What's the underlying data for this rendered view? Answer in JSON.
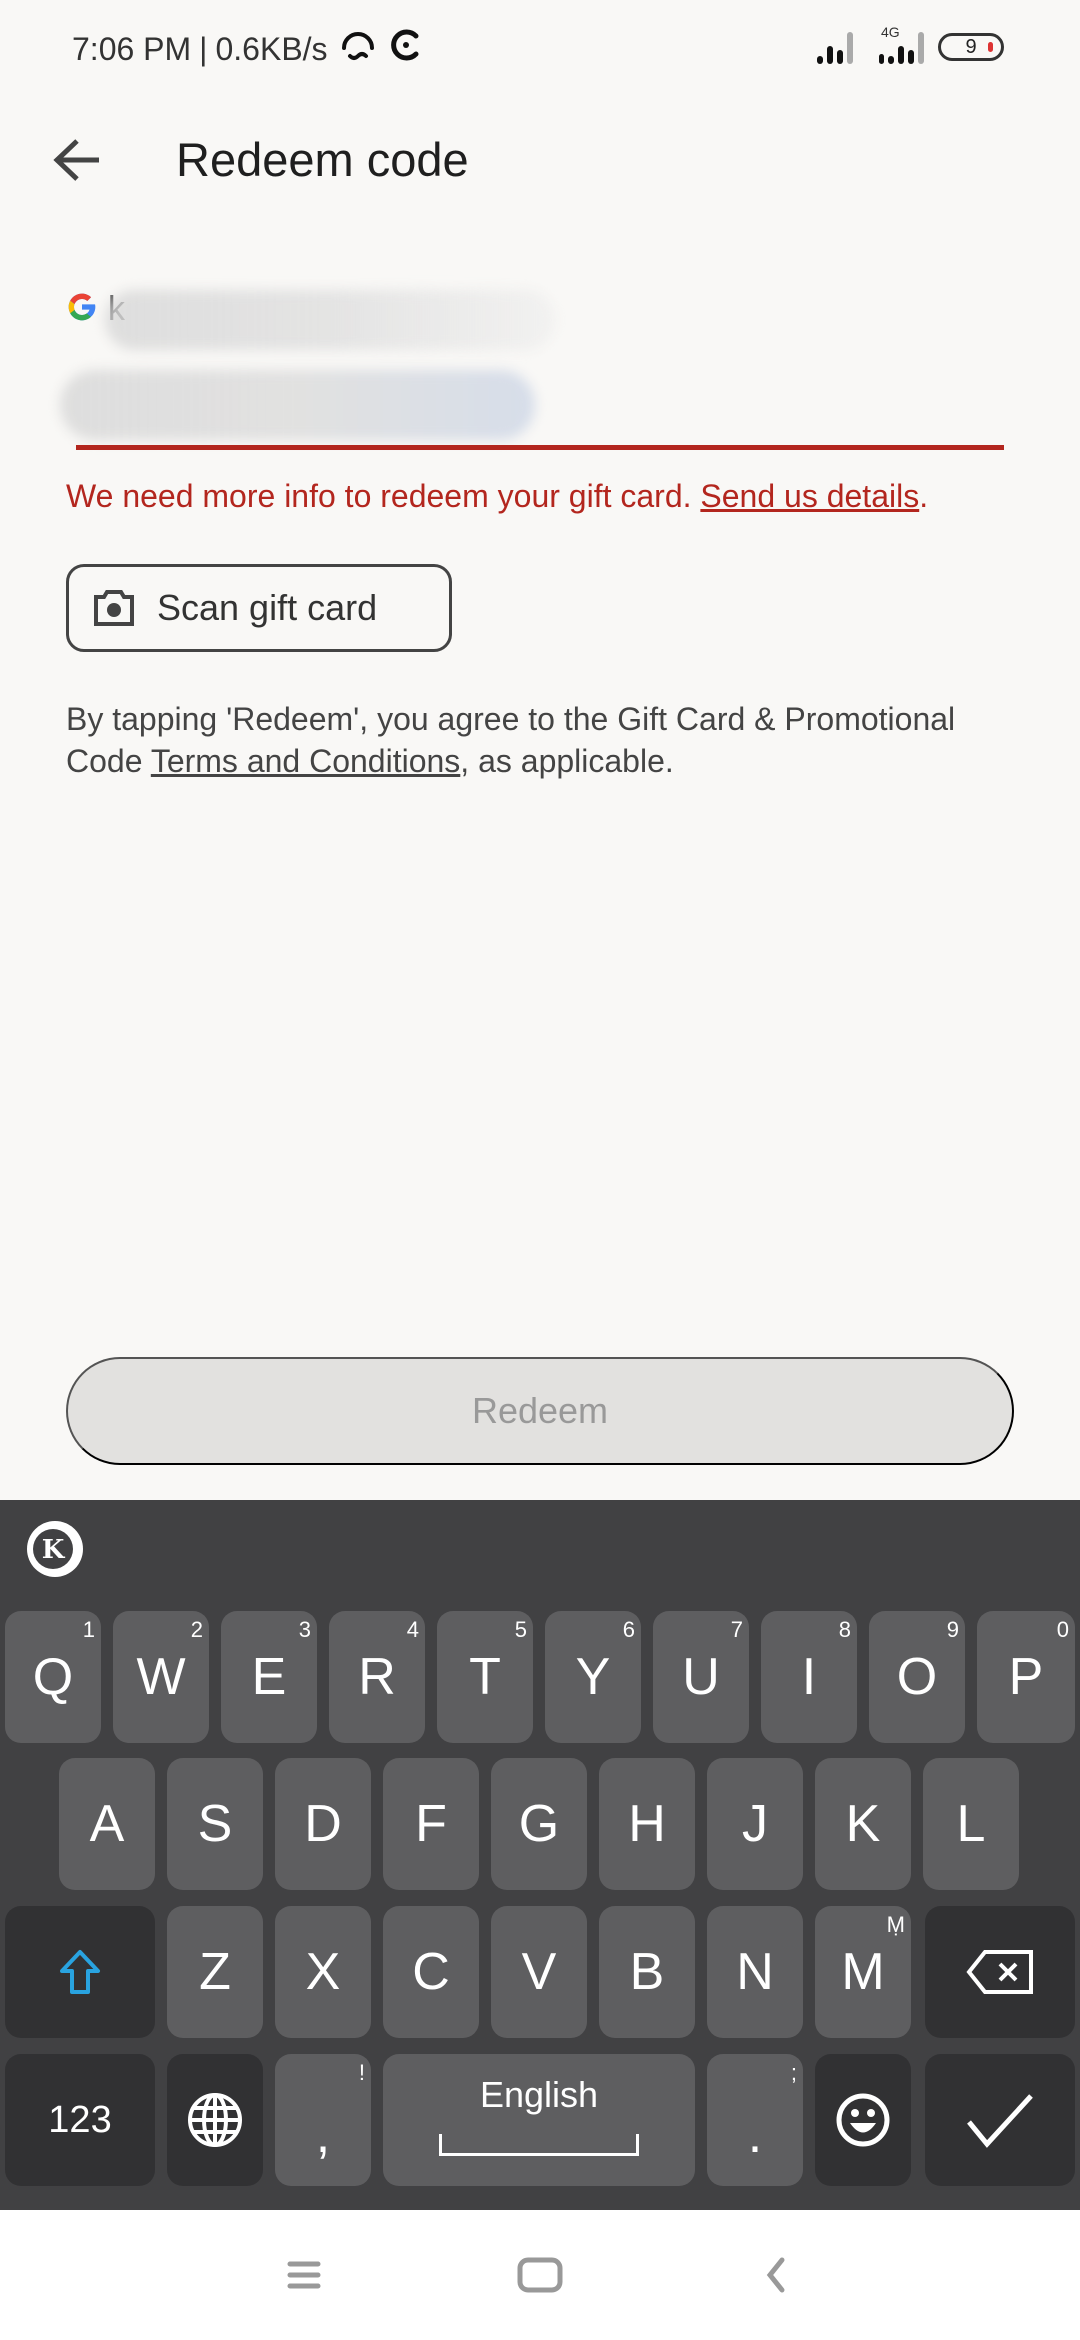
{
  "status_bar": {
    "time": "7:06 PM",
    "separator": "|",
    "net_speed": "0.6KB/s",
    "network_type": "4G",
    "battery_level": "9",
    "icons": [
      "hotspot-icon",
      "sync-icon",
      "signal-icon",
      "signal-icon",
      "battery-icon"
    ]
  },
  "header": {
    "back_icon": "arrow-left-icon",
    "title": "Redeem code"
  },
  "account": {
    "icon": "google-logo-icon",
    "visible_text": "k"
  },
  "code_input": {
    "value": "",
    "placeholder": ""
  },
  "error": {
    "message": "We need more info to redeem your gift card. ",
    "link": "Send us details",
    "suffix": ".",
    "color": "#b3261e"
  },
  "scan_button": {
    "icon": "camera-icon",
    "label": "Scan gift card"
  },
  "terms": {
    "prefix": "By tapping 'Redeem', you agree to the Gift Card & Promotional Code ",
    "link": "Terms and Conditions",
    "suffix": ", as applicable."
  },
  "redeem_button": {
    "label": "Redeem",
    "enabled": false
  },
  "keyboard": {
    "row1": [
      {
        "key": "Q",
        "hint": "1"
      },
      {
        "key": "W",
        "hint": "2"
      },
      {
        "key": "E",
        "hint": "3"
      },
      {
        "key": "R",
        "hint": "4"
      },
      {
        "key": "T",
        "hint": "5"
      },
      {
        "key": "Y",
        "hint": "6"
      },
      {
        "key": "U",
        "hint": "7"
      },
      {
        "key": "I",
        "hint": "8"
      },
      {
        "key": "O",
        "hint": "9"
      },
      {
        "key": "P",
        "hint": "0"
      }
    ],
    "row2": [
      "A",
      "S",
      "D",
      "F",
      "G",
      "H",
      "J",
      "K",
      "L"
    ],
    "row3": [
      {
        "key": "Z",
        "hint": ""
      },
      {
        "key": "X",
        "hint": ""
      },
      {
        "key": "C",
        "hint": ""
      },
      {
        "key": "V",
        "hint": ""
      },
      {
        "key": "B",
        "hint": ""
      },
      {
        "key": "N",
        "hint": ""
      },
      {
        "key": "M",
        "hint": "Ṃ"
      }
    ],
    "numbers_key": "123",
    "comma_key": ",",
    "comma_hint": "!",
    "space_label": "English",
    "period_key": ".",
    "period_hint": ";",
    "shift_color": "#29a3e0"
  },
  "nav_bar": {
    "icons": [
      "menu-icon",
      "home-icon",
      "back-icon"
    ]
  }
}
